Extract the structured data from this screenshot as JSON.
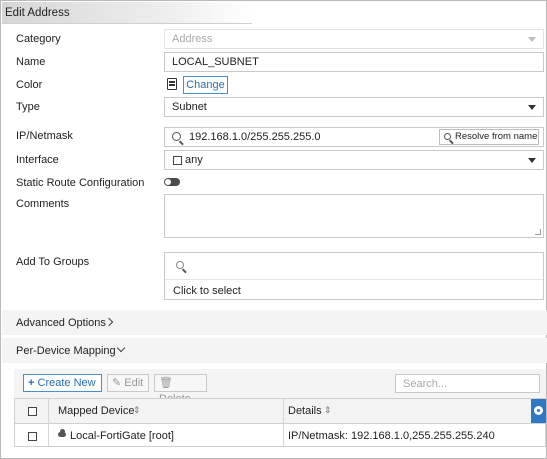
{
  "window": {
    "title": "Edit Address"
  },
  "form": {
    "category": {
      "label": "Category",
      "value": "Address"
    },
    "name": {
      "label": "Name",
      "value": "LOCAL_SUBNET"
    },
    "color": {
      "label": "Color",
      "button": "Change"
    },
    "type": {
      "label": "Type",
      "value": "Subnet"
    },
    "ip_netmask": {
      "label": "IP/Netmask",
      "value": "192.168.1.0/255.255.255.0",
      "resolve_button": "Resolve from name"
    },
    "interface": {
      "label": "Interface",
      "value": "any"
    },
    "static_route": {
      "label": "Static Route Configuration",
      "enabled": false
    },
    "comments": {
      "label": "Comments",
      "value": ""
    },
    "groups": {
      "label": "Add To Groups",
      "search_placeholder": "",
      "select_text": "Click to select"
    }
  },
  "sections": {
    "advanced": "Advanced Options",
    "per_device": "Per-Device Mapping"
  },
  "toolbar": {
    "create_new": "Create New",
    "edit": "Edit",
    "delete": "Delete",
    "search_placeholder": "Search..."
  },
  "table": {
    "columns": [
      "Mapped Device",
      "Details"
    ],
    "rows": [
      {
        "device": "Local-FortiGate [root]",
        "details": "IP/Netmask: 192.168.1.0,255.255.255.240"
      }
    ]
  },
  "icons": {
    "color": "note-book-icon",
    "search": "search-icon",
    "settings": "gear-icon",
    "device": "cloud-icon"
  },
  "colors": {
    "accent": "#2f78c4",
    "section_bg": "#f4f4f4"
  }
}
